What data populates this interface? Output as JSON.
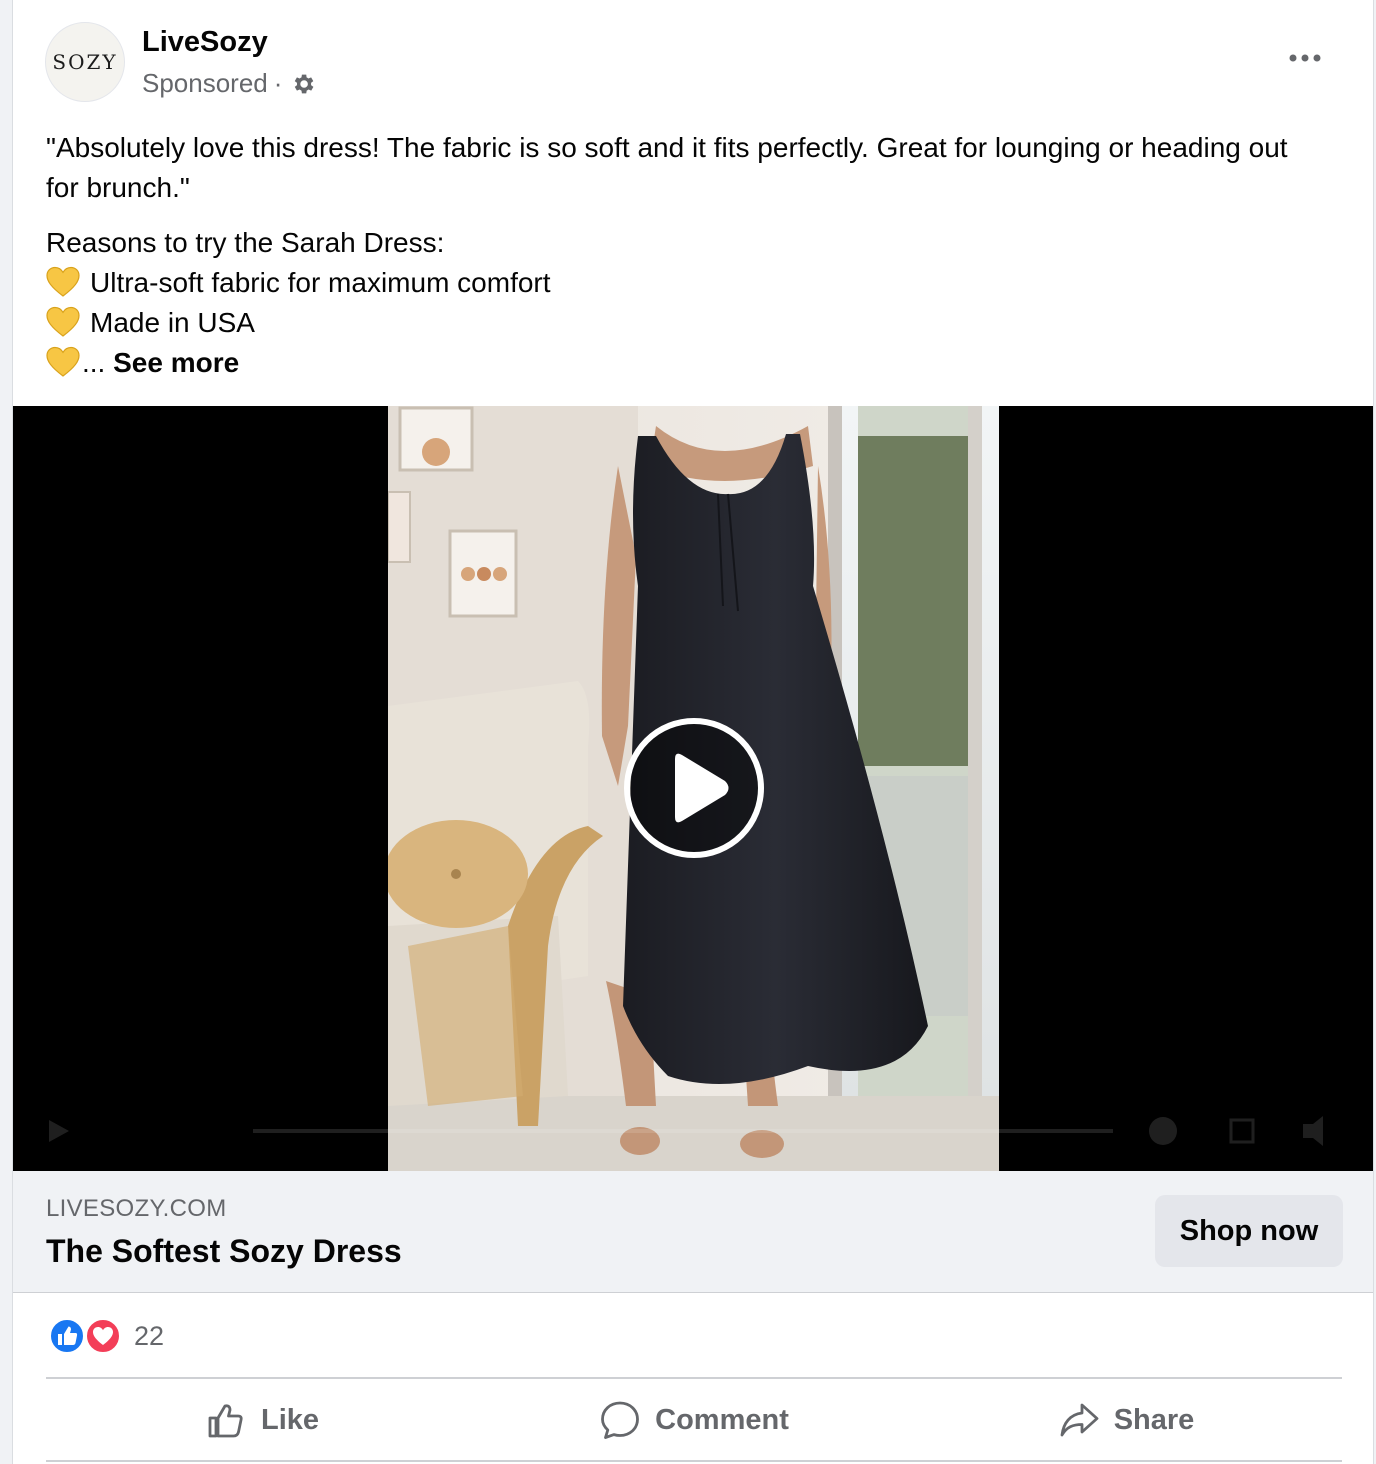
{
  "post": {
    "page_name": "LiveSozy",
    "avatar_text": "SOZY",
    "sponsored_label": "Sponsored",
    "separator": "·",
    "icons": {
      "privacy": "gear-icon",
      "more": "more-options-icon"
    }
  },
  "body": {
    "quote": "\"Absolutely love this dress! The fabric is so soft and it fits perfectly. Great for lounging or heading out for brunch.\"",
    "intro": "Reasons to try the Sarah Dress:",
    "bullets": [
      {
        "icon": "yellow-heart-icon",
        "text": "Ultra-soft fabric for maximum comfort"
      },
      {
        "icon": "yellow-heart-icon",
        "text": "Made in USA"
      }
    ],
    "truncation": "...",
    "see_more": "See more"
  },
  "video": {
    "state": "paused",
    "play_icon": "play-icon"
  },
  "link": {
    "domain": "LIVESOZY.COM",
    "headline": "The Softest Sozy Dress",
    "cta": "Shop now"
  },
  "reactions": {
    "types": [
      "like-reaction-icon",
      "love-reaction-icon"
    ],
    "count": "22"
  },
  "actions": {
    "like": "Like",
    "comment": "Comment",
    "share": "Share"
  },
  "colors": {
    "like_blue": "#1877f2",
    "love_red": "#f33e58",
    "heart_yellow": "#f7c644",
    "secondary_text": "#65676b",
    "button_bg": "#e4e6eb"
  }
}
